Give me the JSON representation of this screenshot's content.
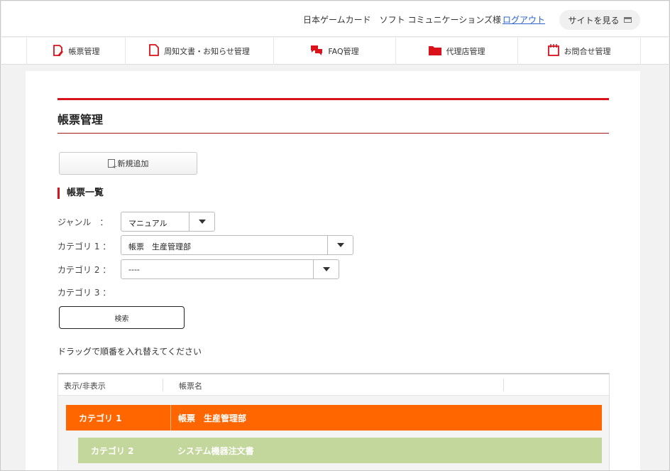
{
  "header": {
    "company": "日本ゲームカード　ソフト コミュニケーションズ様",
    "logout": "ログアウト",
    "site_button": "サイトを見る"
  },
  "nav": {
    "items": [
      {
        "label": "帳票管理",
        "icon": "form-edit-icon"
      },
      {
        "label": "周知文書・お知らせ管理",
        "icon": "document-icon"
      },
      {
        "label": "FAQ管理",
        "icon": "chat-bubbles-icon"
      },
      {
        "label": "代理店管理",
        "icon": "folder-icon"
      },
      {
        "label": "お問合せ管理",
        "icon": "notepad-icon"
      }
    ]
  },
  "colors": {
    "accent_red": "#d9121b",
    "row_category1": "#ff6600",
    "row_category2": "#c3d79c",
    "link_blue": "#2a62c9"
  },
  "page": {
    "title": "帳票管理",
    "add_button": "新規追加",
    "section_title": "帳票一覧",
    "filters": {
      "genre_label": "ジャンル　：",
      "genre_value": "マニュアル",
      "category1_label": "カテゴリ 1 ：",
      "category1_value": "帳票　生産管理部",
      "category2_label": "カテゴリ 2 ：",
      "category2_value": "----",
      "category3_label": "カテゴリ 3 ："
    },
    "search_button": "検索",
    "drag_note": "ドラッグで順番を入れ替えてください"
  },
  "table": {
    "headers": [
      "表示/非表示",
      "帳票名"
    ],
    "rows": [
      {
        "level": "カテゴリ 1",
        "name": "帳票　生産管理部"
      },
      {
        "level": "カテゴリ 2",
        "name": "システム機器注文書"
      }
    ]
  }
}
